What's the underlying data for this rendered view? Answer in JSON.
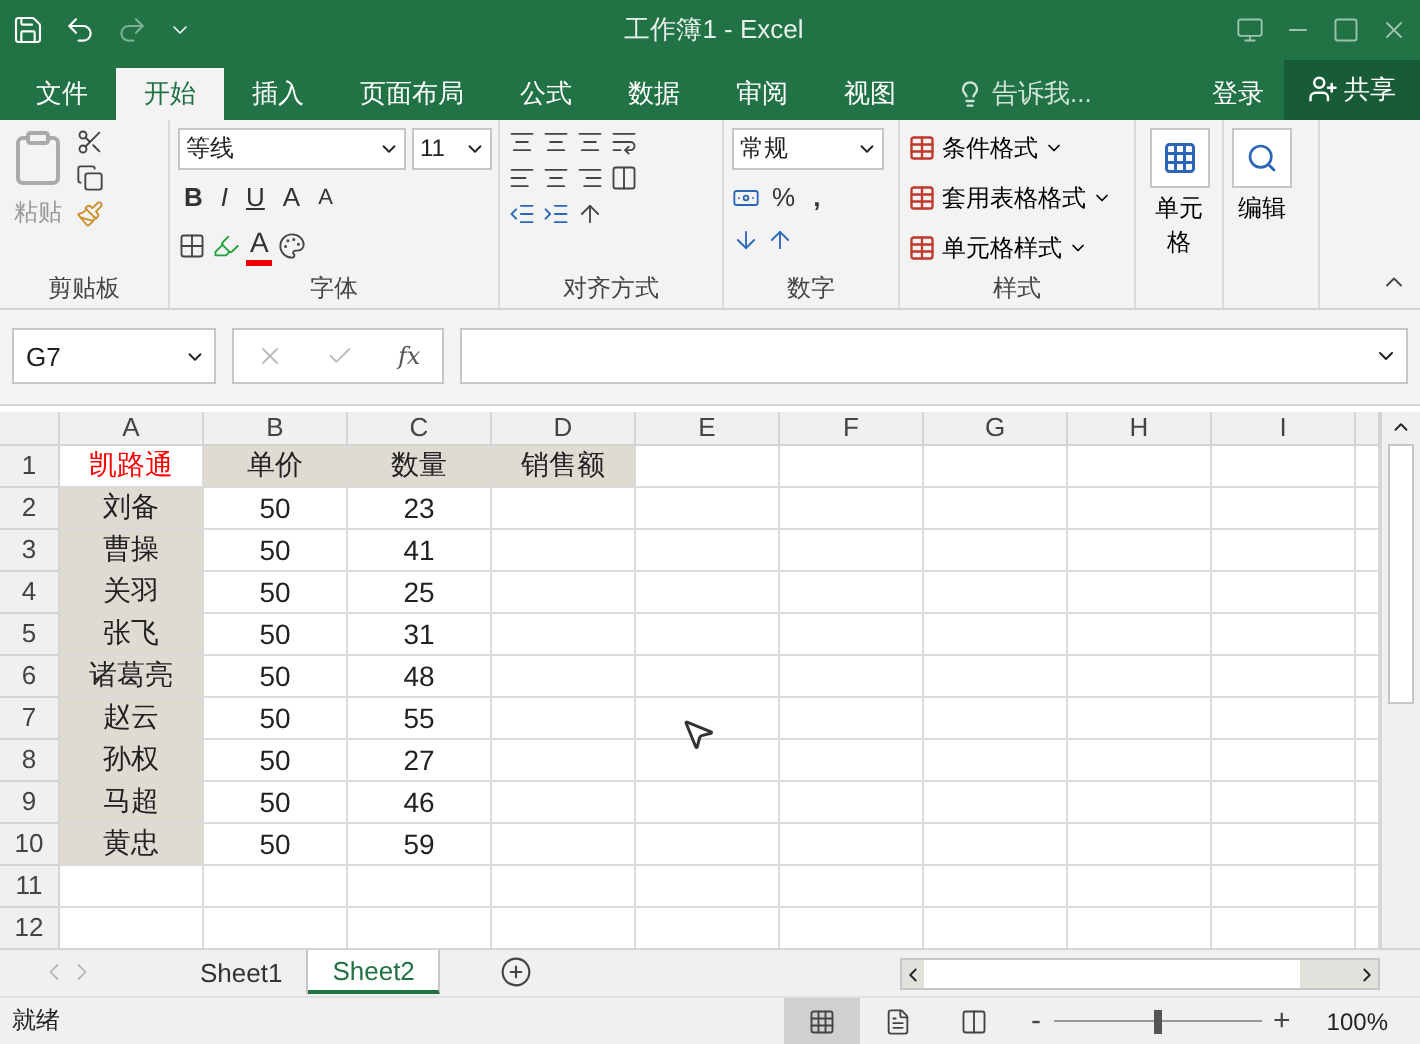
{
  "window": {
    "title": "工作簿1 - Excel"
  },
  "menu_tabs": [
    {
      "label": "文件",
      "selected": false
    },
    {
      "label": "开始",
      "selected": true
    },
    {
      "label": "插入",
      "selected": false
    },
    {
      "label": "页面布局",
      "selected": false
    },
    {
      "label": "公式",
      "selected": false
    },
    {
      "label": "数据",
      "selected": false
    },
    {
      "label": "审阅",
      "selected": false
    },
    {
      "label": "视图",
      "selected": false
    }
  ],
  "tell_me": "告诉我...",
  "login": "登录",
  "share": "共享",
  "ribbon": {
    "clipboard": {
      "paste": "粘贴",
      "label": "剪贴板"
    },
    "font": {
      "font_name": "等线",
      "font_size": "11",
      "bold": "B",
      "italic": "I",
      "underline": "U",
      "grow": "A",
      "shrink": "A",
      "font_color": "A",
      "label": "字体"
    },
    "alignment": {
      "label": "对齐方式"
    },
    "number": {
      "format": "常规",
      "percent": "%",
      "comma": ",",
      "label": "数字"
    },
    "styles": {
      "items": [
        "条件格式",
        "套用表格格式",
        "单元格样式"
      ],
      "label": "样式"
    },
    "cells": {
      "label": "单元格"
    },
    "editing": {
      "label": "编辑"
    }
  },
  "formula_bar": {
    "name_box": "G7",
    "fx": "fx"
  },
  "sheet": {
    "columns": [
      "A",
      "B",
      "C",
      "D",
      "E",
      "F",
      "G",
      "H",
      "I"
    ],
    "rows": [
      {
        "header": "1",
        "cells": [
          {
            "text": "凯路通",
            "shaded": false,
            "color": "#ff0000"
          },
          {
            "text": "单价",
            "shaded": true
          },
          {
            "text": "数量",
            "shaded": true
          },
          {
            "text": "销售额",
            "shaded": true
          }
        ]
      },
      {
        "header": "2",
        "cells": [
          {
            "text": "刘备",
            "shaded": true
          },
          {
            "text": "50",
            "shaded": false
          },
          {
            "text": "23",
            "shaded": false
          }
        ]
      },
      {
        "header": "3",
        "cells": [
          {
            "text": "曹操",
            "shaded": true
          },
          {
            "text": "50",
            "shaded": false
          },
          {
            "text": "41",
            "shaded": false
          }
        ]
      },
      {
        "header": "4",
        "cells": [
          {
            "text": "关羽",
            "shaded": true
          },
          {
            "text": "50",
            "shaded": false
          },
          {
            "text": "25",
            "shaded": false
          }
        ]
      },
      {
        "header": "5",
        "cells": [
          {
            "text": "张飞",
            "shaded": true
          },
          {
            "text": "50",
            "shaded": false
          },
          {
            "text": "31",
            "shaded": false
          }
        ]
      },
      {
        "header": "6",
        "cells": [
          {
            "text": "诸葛亮",
            "shaded": true
          },
          {
            "text": "50",
            "shaded": false
          },
          {
            "text": "48",
            "shaded": false
          }
        ]
      },
      {
        "header": "7",
        "cells": [
          {
            "text": "赵云",
            "shaded": true
          },
          {
            "text": "50",
            "shaded": false
          },
          {
            "text": "55",
            "shaded": false
          }
        ]
      },
      {
        "header": "8",
        "cells": [
          {
            "text": "孙权",
            "shaded": true
          },
          {
            "text": "50",
            "shaded": false
          },
          {
            "text": "27",
            "shaded": false
          }
        ]
      },
      {
        "header": "9",
        "cells": [
          {
            "text": "马超",
            "shaded": true
          },
          {
            "text": "50",
            "shaded": false
          },
          {
            "text": "46",
            "shaded": false
          }
        ]
      },
      {
        "header": "10",
        "cells": [
          {
            "text": "黄忠",
            "shaded": true
          },
          {
            "text": "50",
            "shaded": false
          },
          {
            "text": "59",
            "shaded": false
          }
        ]
      },
      {
        "header": "11"
      },
      {
        "header": "12"
      }
    ]
  },
  "sheet_tabs": [
    {
      "label": "Sheet1",
      "selected": false
    },
    {
      "label": "Sheet2",
      "selected": true
    }
  ],
  "status_bar": {
    "status": "就绪",
    "zoom_out": "-",
    "zoom_in": "+",
    "zoom": {
      "level": 0.5
    },
    "zoom_label": "100%"
  }
}
